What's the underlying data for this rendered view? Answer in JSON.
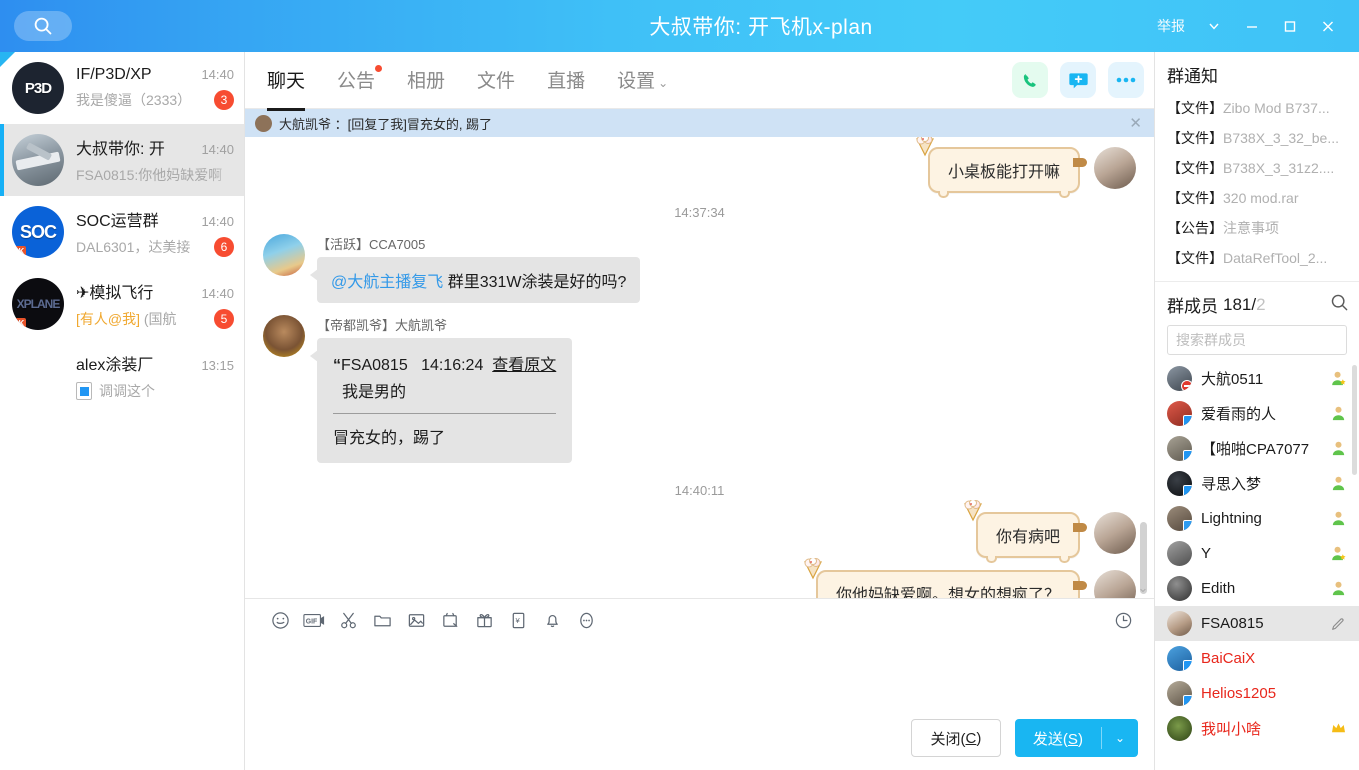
{
  "titlebar": {
    "title": "大叔带你: 开飞机x-plan",
    "report_label": "举报",
    "search_icon": "search-icon",
    "chevron_icon": "chevron-down-icon",
    "minimize_icon": "minimize-icon",
    "maximize_icon": "maximize-icon",
    "close_icon": "close-icon"
  },
  "sidebar": {
    "conversations": [
      {
        "name": "IF/P3D/XP",
        "time": "14:40",
        "preview": "我是傻逼（2333）",
        "unread": "3",
        "avatar_label": "P3D",
        "avatar_bg": "#1d2430",
        "flag2k": false,
        "active": false,
        "newflag": true,
        "mobile": false,
        "at": false
      },
      {
        "name": "大叔带你: 开",
        "time": "14:40",
        "preview": "FSA0815:你他妈缺爱啊",
        "unread": "",
        "avatar_label": "",
        "avatar_bg": "#96a2ac",
        "flag2k": false,
        "active": true,
        "newflag": false,
        "mobile": false,
        "at": false
      },
      {
        "name": "SOC运营群",
        "time": "14:40",
        "preview": "DAL6301，达美接",
        "unread": "6",
        "avatar_label": "SOC",
        "avatar_bg": "#0a62d8",
        "flag2k": true,
        "active": false,
        "newflag": false,
        "mobile": false,
        "at": false
      },
      {
        "name": "✈模拟飞行",
        "time": "14:40",
        "preview_at": "[有人@我]",
        "preview": " (国航",
        "unread": "5",
        "avatar_label": "XPLANE",
        "avatar_bg": "#0c0c10",
        "flag2k": true,
        "active": false,
        "newflag": false,
        "mobile": false,
        "at": true
      },
      {
        "name": "alex涂装厂",
        "time": "13:15",
        "preview": "调调这个",
        "unread": "",
        "avatar_label": "",
        "avatar_bg": "transparent",
        "flag2k": false,
        "active": false,
        "newflag": false,
        "mobile": true,
        "at": false
      }
    ]
  },
  "tabs": [
    {
      "label": "聊天",
      "active": true,
      "dot": false,
      "caret": false
    },
    {
      "label": "公告",
      "active": false,
      "dot": true,
      "caret": false
    },
    {
      "label": "相册",
      "active": false,
      "dot": false,
      "caret": false
    },
    {
      "label": "文件",
      "active": false,
      "dot": false,
      "caret": false
    },
    {
      "label": "直播",
      "active": false,
      "dot": false,
      "caret": false
    },
    {
      "label": "设置",
      "active": false,
      "dot": false,
      "caret": true
    }
  ],
  "header_actions": {
    "call_icon": "phone-icon",
    "add_icon": "add-member-icon",
    "more_icon": "more-options-icon"
  },
  "reply_banner": {
    "text": "大航凯爷 ：[回复了我]冒充女的, 踢了",
    "close_icon": "close-icon"
  },
  "messages": [
    {
      "id": "m1",
      "dir": "out",
      "text": "小桌板能打开嘛"
    },
    {
      "id": "t1",
      "dir": "time",
      "text": "14:37:34"
    },
    {
      "id": "m2",
      "dir": "in",
      "sender": "【活跃】CCA7005",
      "mention": "@大航主播复飞",
      "text": "群里331W涂装是好的吗?"
    },
    {
      "id": "m3",
      "dir": "in-quote",
      "sender": "【帝都凯爷】大航凯爷",
      "quote_name": "FSA0815",
      "quote_time": "14:16:24",
      "quote_link": "查看原文",
      "quote_body": "我是男的",
      "text": "冒充女的，踢了"
    },
    {
      "id": "t2",
      "dir": "time",
      "text": "14:40:11"
    },
    {
      "id": "m4",
      "dir": "out",
      "text": "你有病吧"
    },
    {
      "id": "m5",
      "dir": "out",
      "text": "你他妈缺爱啊。想女的想疯了？"
    }
  ],
  "toolbar": {
    "icons": [
      "emoji-icon",
      "gif-icon",
      "scissors-icon",
      "folder-icon",
      "image-icon",
      "screenshot-icon",
      "gift-icon",
      "red-packet-icon",
      "bell-icon",
      "more-icon"
    ],
    "history_icon": "chat-history-icon",
    "close_label": "关闭(",
    "close_key": "C",
    "close_label_end": ")",
    "send_label": "发送(",
    "send_key": "S",
    "send_label_end": ")",
    "send_caret_icon": "chevron-down-icon"
  },
  "right_panel": {
    "notice_title": "群通知",
    "notices": [
      {
        "tag": "【文件】",
        "text": "Zibo Mod B737..."
      },
      {
        "tag": "【文件】",
        "text": "B738X_3_32_be..."
      },
      {
        "tag": "【文件】",
        "text": "B738X_3_31z2...."
      },
      {
        "tag": "【文件】",
        "text": "320 mod.rar"
      },
      {
        "tag": "【公告】",
        "text": "注意事项"
      },
      {
        "tag": "【文件】",
        "text": "DataRefTool_2..."
      }
    ],
    "members_title": "群成员",
    "members_count": "181/",
    "members_total": "2",
    "members_search_icon": "search-icon",
    "search_placeholder": "搜索群成员",
    "members": [
      {
        "name": "大航0511",
        "color": "dark",
        "role": "admin-star",
        "badge": "mute",
        "avatar_bg": "#5b6470",
        "selected": false
      },
      {
        "name": "爱看雨的人",
        "color": "dark",
        "role": "member",
        "badge": "none",
        "avatar_bg": "#c0392b",
        "selected": false
      },
      {
        "name": "【啪啪CPA7077",
        "color": "dark",
        "role": "member",
        "badge": "phone",
        "avatar_bg": "#8b8577",
        "selected": false
      },
      {
        "name": "寻思入梦",
        "color": "dark",
        "role": "member",
        "badge": "phone",
        "avatar_bg": "#111418",
        "selected": false
      },
      {
        "name": "Lightning",
        "color": "dark",
        "role": "member",
        "badge": "blue-plus",
        "avatar_bg": "#6f6257",
        "selected": false
      },
      {
        "name": "Y",
        "color": "dark",
        "role": "admin-star",
        "badge": "none",
        "avatar_bg": "#6e6e6e",
        "selected": false
      },
      {
        "name": "Edith",
        "color": "dark",
        "role": "member",
        "badge": "none",
        "avatar_bg": "#4a4a4a",
        "selected": false
      },
      {
        "name": "FSA0815",
        "color": "dark",
        "role": "edit",
        "badge": "none",
        "avatar_bg": "#caa88e",
        "selected": true
      },
      {
        "name": "BaiCaiX",
        "color": "red",
        "role": "none",
        "badge": "phone",
        "avatar_bg": "#2f7fd0",
        "selected": false
      },
      {
        "name": "Helios1205",
        "color": "red",
        "role": "none",
        "badge": "phone",
        "avatar_bg": "#8b8071",
        "selected": false
      },
      {
        "name": "我叫小啥",
        "color": "red",
        "role": "crown",
        "badge": "none",
        "avatar_bg": "#4a6a2a",
        "selected": false
      }
    ]
  },
  "colors": {
    "accent": "#19b6f2",
    "title_gradient_start": "#2e8ef0",
    "title_gradient_end": "#44cbf8",
    "unread_badge": "#f74c31",
    "bubble_in": "#e4e4e4",
    "bubble_out": "#fdf3e3",
    "bubble_out_border": "#e5c79b",
    "mention": "#3399e8",
    "member_red": "#e8271c",
    "at_marker": "#f0a830"
  }
}
